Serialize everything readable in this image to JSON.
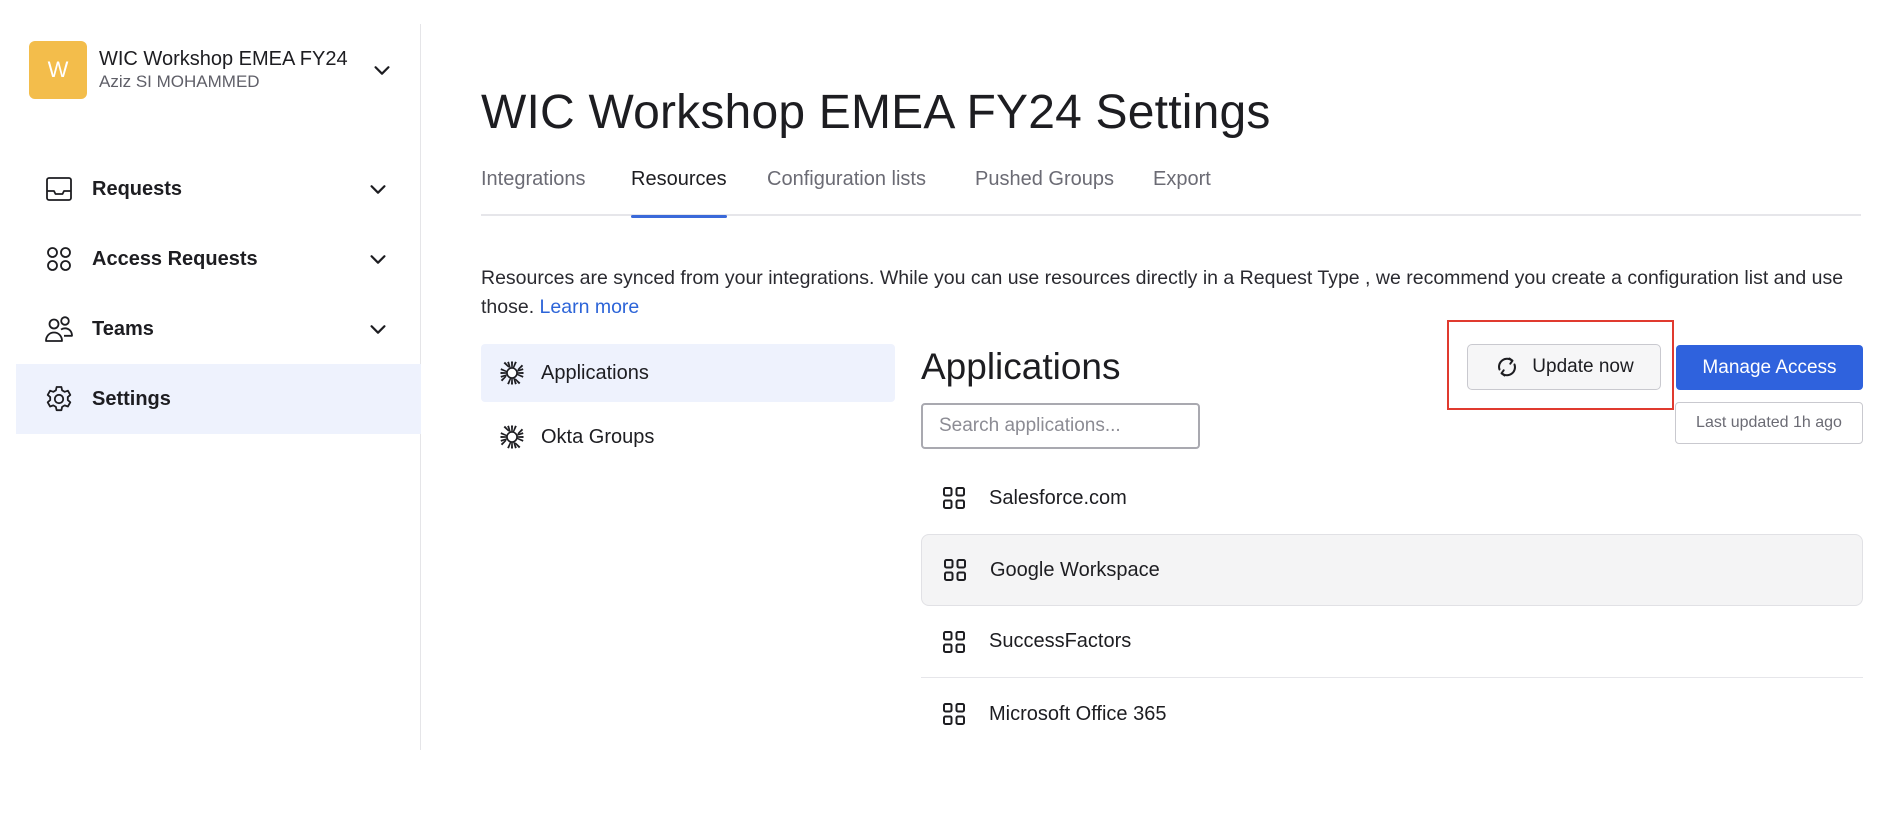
{
  "org": {
    "avatar_letter": "W",
    "name": "WIC Workshop EMEA FY24",
    "user": "Aziz SI MOHAMMED",
    "avatar_color": "#f3bd4b"
  },
  "sidebar": {
    "items": [
      {
        "label": "Requests",
        "icon": "inbox-icon"
      },
      {
        "label": "Access Requests",
        "icon": "grid-circles-icon"
      },
      {
        "label": "Teams",
        "icon": "people-icon"
      },
      {
        "label": "Settings",
        "icon": "gear-icon"
      }
    ]
  },
  "page": {
    "title": "WIC Workshop EMEA FY24 Settings"
  },
  "tabs": [
    {
      "label": "Integrations"
    },
    {
      "label": "Resources"
    },
    {
      "label": "Configuration lists"
    },
    {
      "label": "Pushed Groups"
    },
    {
      "label": "Export"
    }
  ],
  "description": {
    "text": "Resources are synced from your integrations. While you can use resources directly in a Request Type , we recommend you create a configuration list and use those.",
    "link": "Learn more"
  },
  "resources": [
    {
      "label": "Applications",
      "icon": "okta-sun-icon"
    },
    {
      "label": "Okta Groups",
      "icon": "okta-sun-icon"
    }
  ],
  "apps_panel": {
    "title": "Applications",
    "search_placeholder": "Search applications...",
    "update_label": "Update now",
    "manage_label": "Manage Access",
    "last_updated": "Last updated 1h ago",
    "accent": "#2f62dd",
    "highlight_color": "#e03a2f",
    "apps": [
      {
        "label": "Salesforce.com"
      },
      {
        "label": "Google Workspace"
      },
      {
        "label": "SuccessFactors"
      },
      {
        "label": "Microsoft Office 365"
      }
    ]
  }
}
